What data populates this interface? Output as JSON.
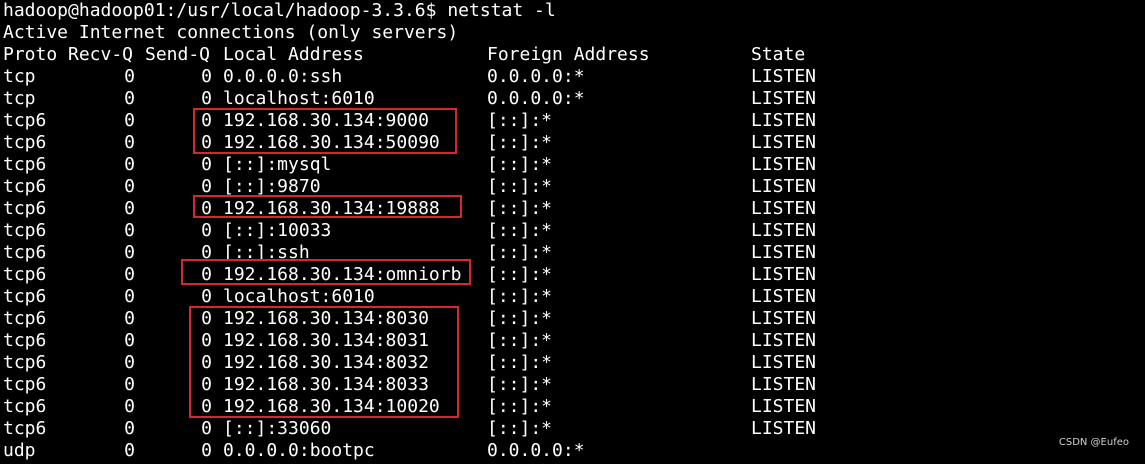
{
  "terminal": {
    "prompt_line": "hadoop@hadoop01:/usr/local/hadoop-3.3.6$ netstat -l",
    "heading": "Active Internet connections (only servers)",
    "columns": {
      "proto": "Proto",
      "recv": "Recv-Q",
      "send": "Send-Q",
      "local": "Local Address",
      "foreign": "Foreign Address",
      "state": "State"
    },
    "rows": [
      {
        "proto": "tcp",
        "recv": "0",
        "send": "0",
        "local": "0.0.0.0:ssh",
        "foreign": "0.0.0.0:*",
        "state": "LISTEN"
      },
      {
        "proto": "tcp",
        "recv": "0",
        "send": "0",
        "local": "localhost:6010",
        "foreign": "0.0.0.0:*",
        "state": "LISTEN"
      },
      {
        "proto": "tcp6",
        "recv": "0",
        "send": "0",
        "local": "192.168.30.134:9000",
        "foreign": "[::]:*",
        "state": "LISTEN"
      },
      {
        "proto": "tcp6",
        "recv": "0",
        "send": "0",
        "local": "192.168.30.134:50090",
        "foreign": "[::]:*",
        "state": "LISTEN"
      },
      {
        "proto": "tcp6",
        "recv": "0",
        "send": "0",
        "local": "[::]:mysql",
        "foreign": "[::]:*",
        "state": "LISTEN"
      },
      {
        "proto": "tcp6",
        "recv": "0",
        "send": "0",
        "local": "[::]:9870",
        "foreign": "[::]:*",
        "state": "LISTEN"
      },
      {
        "proto": "tcp6",
        "recv": "0",
        "send": "0",
        "local": "192.168.30.134:19888",
        "foreign": "[::]:*",
        "state": "LISTEN"
      },
      {
        "proto": "tcp6",
        "recv": "0",
        "send": "0",
        "local": "[::]:10033",
        "foreign": "[::]:*",
        "state": "LISTEN"
      },
      {
        "proto": "tcp6",
        "recv": "0",
        "send": "0",
        "local": "[::]:ssh",
        "foreign": "[::]:*",
        "state": "LISTEN"
      },
      {
        "proto": "tcp6",
        "recv": "0",
        "send": "0",
        "local": "192.168.30.134:omniorb",
        "foreign": "[::]:*",
        "state": "LISTEN"
      },
      {
        "proto": "tcp6",
        "recv": "0",
        "send": "0",
        "local": "localhost:6010",
        "foreign": "[::]:*",
        "state": "LISTEN"
      },
      {
        "proto": "tcp6",
        "recv": "0",
        "send": "0",
        "local": "192.168.30.134:8030",
        "foreign": "[::]:*",
        "state": "LISTEN"
      },
      {
        "proto": "tcp6",
        "recv": "0",
        "send": "0",
        "local": "192.168.30.134:8031",
        "foreign": "[::]:*",
        "state": "LISTEN"
      },
      {
        "proto": "tcp6",
        "recv": "0",
        "send": "0",
        "local": "192.168.30.134:8032",
        "foreign": "[::]:*",
        "state": "LISTEN"
      },
      {
        "proto": "tcp6",
        "recv": "0",
        "send": "0",
        "local": "192.168.30.134:8033",
        "foreign": "[::]:*",
        "state": "LISTEN"
      },
      {
        "proto": "tcp6",
        "recv": "0",
        "send": "0",
        "local": "192.168.30.134:10020",
        "foreign": "[::]:*",
        "state": "LISTEN"
      },
      {
        "proto": "tcp6",
        "recv": "0",
        "send": "0",
        "local": "[::]:33060",
        "foreign": "[::]:*",
        "state": "LISTEN"
      },
      {
        "proto": "udp",
        "recv": "0",
        "send": "0",
        "local": "0.0.0.0:bootpc",
        "foreign": "0.0.0.0:*",
        "state": ""
      }
    ]
  },
  "colors": {
    "background": "#000000",
    "text": "#ffffff",
    "highlight": "#d9262c"
  },
  "watermark": "CSDN @Eufeo"
}
